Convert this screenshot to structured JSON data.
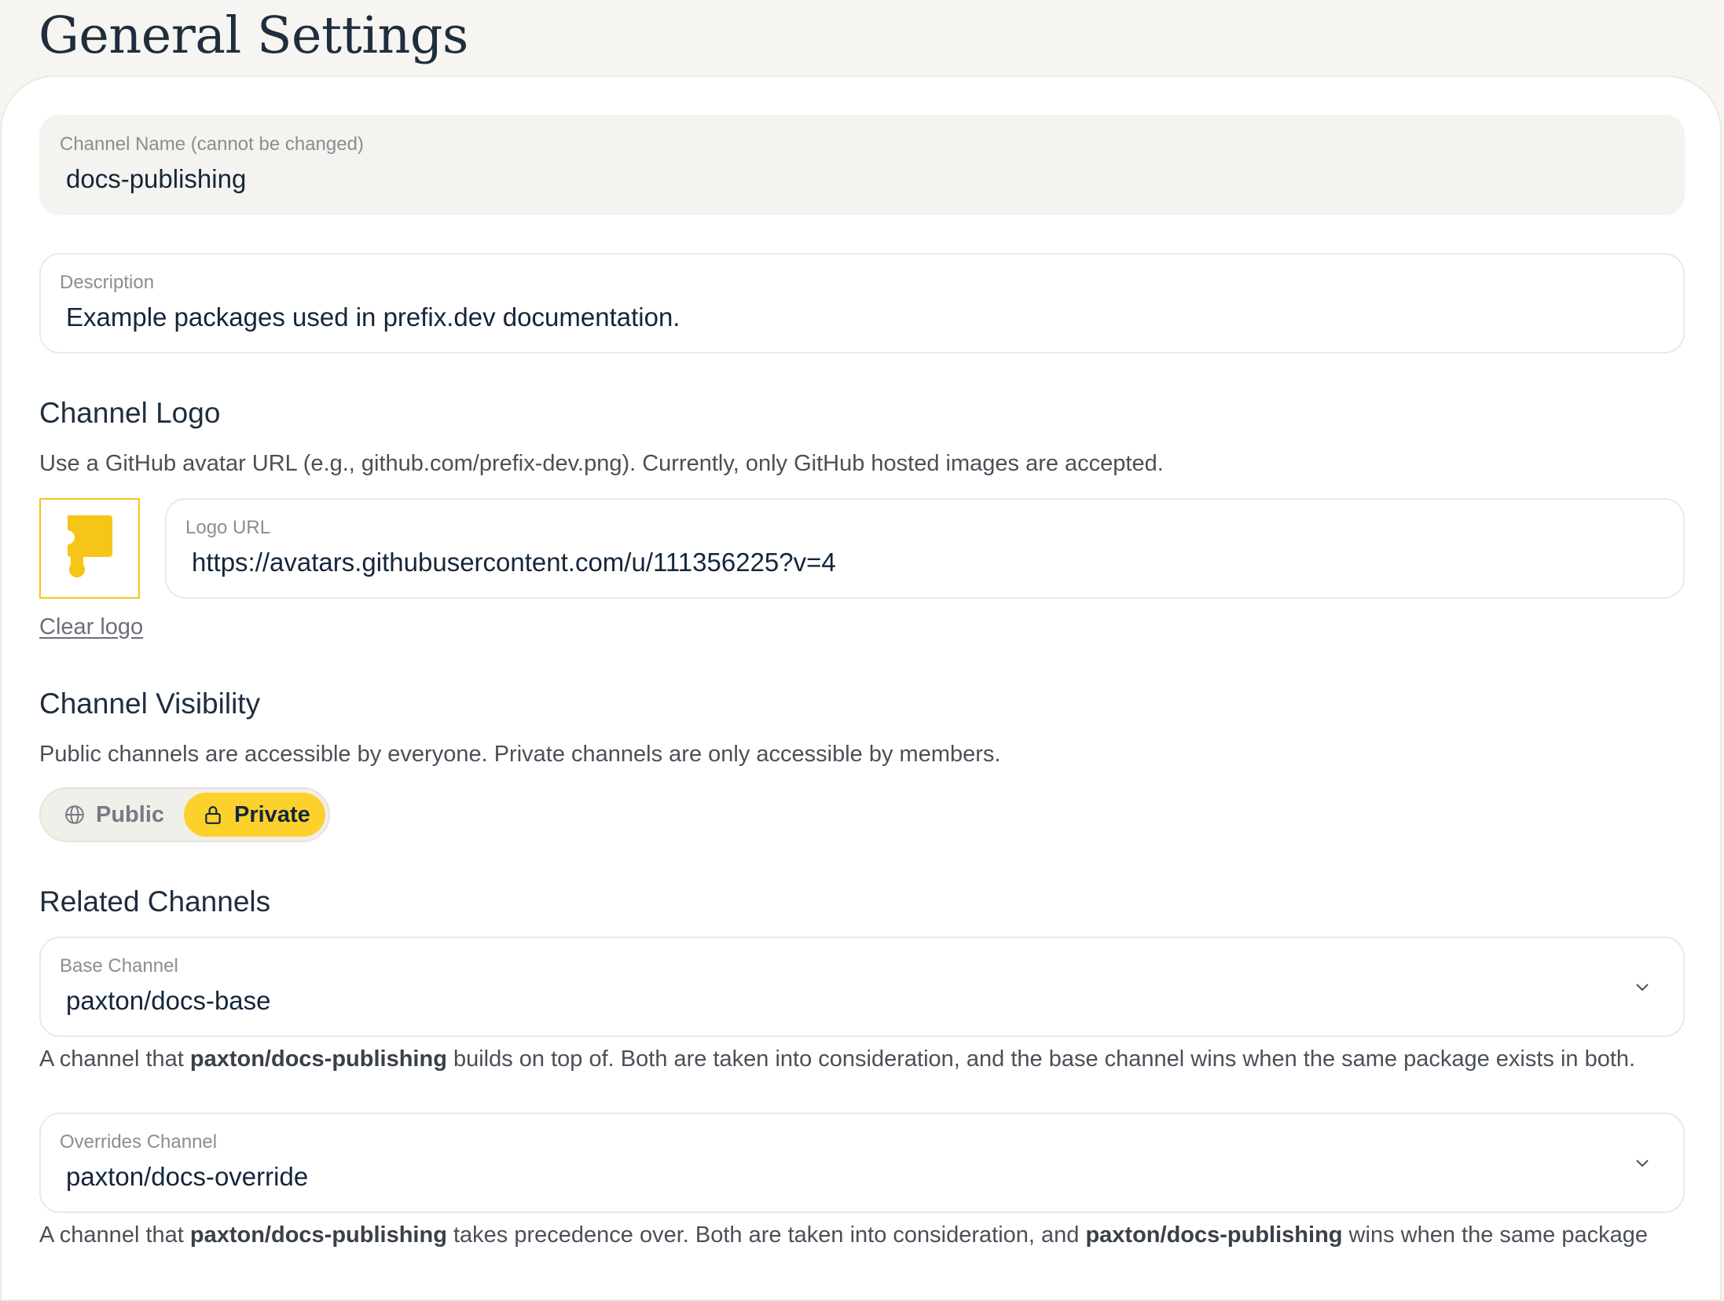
{
  "page": {
    "title": "General Settings"
  },
  "channel_name": {
    "label": "Channel Name (cannot be changed)",
    "value": "docs-publishing"
  },
  "description": {
    "label": "Description",
    "value": "Example packages used in prefix.dev documentation."
  },
  "logo_section": {
    "heading": "Channel Logo",
    "description": "Use a GitHub avatar URL (e.g., github.com/prefix-dev.png). Currently, only GitHub hosted images are accepted.",
    "url_label": "Logo URL",
    "url_value": "https://avatars.githubusercontent.com/u/111356225?v=4",
    "clear_label": "Clear logo",
    "logo_color": "#f5c518",
    "logo_icon": "puzzle-logo"
  },
  "visibility_section": {
    "heading": "Channel Visibility",
    "description": "Public channels are accessible by everyone. Private channels are only accessible by members.",
    "public_label": "Public",
    "private_label": "Private",
    "selected": "Private",
    "selected_color": "#fdd12c"
  },
  "related_section": {
    "heading": "Related Channels",
    "base": {
      "label": "Base Channel",
      "value": "paxton/docs-base",
      "help_prefix": "A channel that ",
      "help_channel": "paxton/docs-publishing",
      "help_suffix": " builds on top of. Both are taken into consideration, and the base channel wins when the same package exists in both."
    },
    "overrides": {
      "label": "Overrides Channel",
      "value": "paxton/docs-override",
      "help_prefix": "A channel that ",
      "help_channel": "paxton/docs-publishing",
      "help_middle": " takes precedence over. Both are taken into consideration, and ",
      "help_channel_2": "paxton/docs-publishing",
      "help_suffix": " wins when the same package"
    }
  }
}
